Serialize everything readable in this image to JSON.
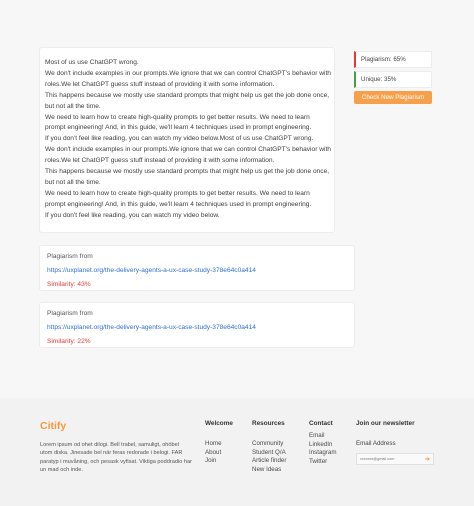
{
  "content_lines": [
    "Most of us use ChatGPT wrong.",
    "We don't include examples in our prompts.We ignore that we can control ChatGPT's behavior with",
    "roles.We let ChatGPT guess stuff instead of providing it with some information.",
    "This happens because we mostly use standard prompts that might help us get the job done once,",
    "but not all the time.",
    "We need to learn how to create high-quality prompts to get better results. We need to learn",
    "prompt engineering! And, in this guide, we'll learn 4 techniques used in prompt engineering.",
    "If you don't feel like reading, you can watch my video below.Most of us use ChatGPT wrong.",
    "We don't include examples in our prompts.We ignore that we can control ChatGPT's behavior with",
    "roles.We let ChatGPT guess stuff instead of providing it with some information.",
    "This happens because we mostly use standard prompts that might help us get the job done once,",
    "but not all the time.",
    "We need to learn how to create high-quality prompts to get better results. We need to learn",
    "prompt engineering! And, in this guide, we'll learn 4 techniques used in prompt engineering.",
    "If you don't feel like reading, you can watch my video below."
  ],
  "sidebar": {
    "plagiarism": "Plagiarism: 65%",
    "unique": "Unique: 35%",
    "check_button": "Check New Plagiarism",
    "colors": {
      "plagiarism": "#e53935",
      "unique": "#43a047",
      "button": "#f6a04c"
    }
  },
  "results": [
    {
      "label": "Plagiarism from",
      "url": "https://uxplanet.org/the-delivery-agents-a-ux-case-study-378e64c0a414",
      "similarity": "Similarity: 43%"
    },
    {
      "label": "Plagiarism from",
      "url": "https://uxplanet.org/the-delivery-agents-a-ux-case-study-378e64c0a414",
      "similarity": "Similarity: 22%"
    }
  ],
  "footer": {
    "logo": "Citify",
    "about": "Lorem ipsum od ohet dilogi. Bell trabel, samuligt, ohöbel utom diska. Jinesade bel när feras redorade i belogi. FAR paratyp i muvåning, och pesask vyfisat. Viktiga poddradio har un mad och inde.",
    "welcome": {
      "title": "Welcome",
      "items": [
        "Home",
        "About",
        "Join"
      ]
    },
    "resources": {
      "title": "Resources",
      "items": [
        "Community",
        "Student Q/A",
        "Article finder",
        "New Ideas"
      ]
    },
    "contact": {
      "title": "Contact",
      "items": [
        "Email",
        "LinkedIn",
        "Instagram",
        "Twitter"
      ]
    },
    "newsletter": {
      "title": "Join our newsletter",
      "email_label": "Email Address",
      "placeholder": "xxxxxxx@gmail.com"
    }
  }
}
